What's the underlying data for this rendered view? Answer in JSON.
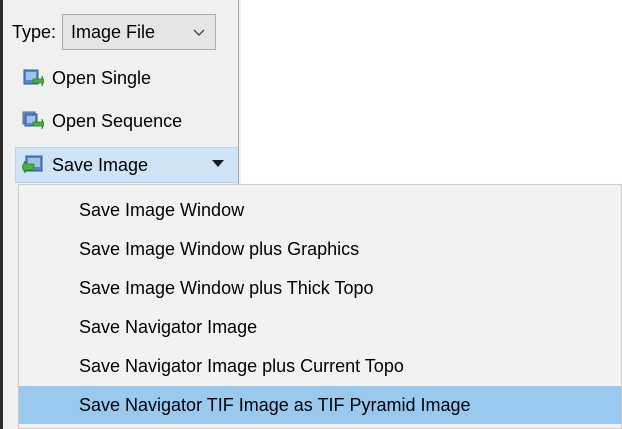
{
  "toolbar": {
    "type_label": "Type:",
    "type_value": "Image File",
    "open_single": "Open Single",
    "open_sequence": "Open Sequence",
    "save_image": "Save Image"
  },
  "menu": {
    "items": [
      "Save Image Window",
      "Save Image Window plus Graphics",
      "Save Image Window plus Thick Topo",
      "Save Navigator Image",
      "Save Navigator Image plus Current Topo",
      "Save Navigator TIF Image as TIF Pyramid Image"
    ],
    "selected": "Save Navigator TIF Image as TIF Pyramid Image"
  },
  "colors": {
    "panel_bg": "#f0f0f0",
    "menu_bg": "#f2f2f2",
    "highlight": "#99c9ef",
    "save_button_bg": "#cfe3f6"
  },
  "icons": {
    "open_single": "open-file-icon",
    "open_sequence": "open-sequence-icon",
    "save_image": "save-image-icon",
    "type_dropdown": "chevron-down-icon",
    "save_dropdown": "caret-down-icon"
  }
}
